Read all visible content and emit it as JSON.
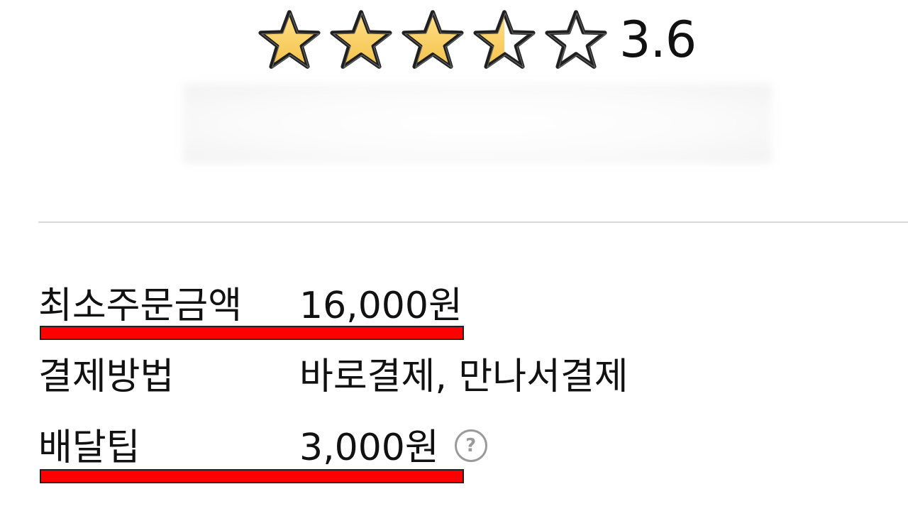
{
  "rating": {
    "value_text": "3.6",
    "value": 3.6,
    "max": 5,
    "star_fill_color": "#F4C24A",
    "stars": [
      {
        "fill": "full"
      },
      {
        "fill": "full"
      },
      {
        "fill": "full"
      },
      {
        "fill": "half"
      },
      {
        "fill": "empty"
      }
    ]
  },
  "info": {
    "min_order": {
      "label": "최소주문금액",
      "value": "16,000원"
    },
    "payment": {
      "label": "결제방법",
      "value": "바로결제, 만나서결제"
    },
    "delivery_tip": {
      "label": "배달팁",
      "value": "3,000원",
      "help_icon": "question-circle-icon",
      "help_glyph": "?"
    }
  },
  "colors": {
    "highlight": "#FF0000",
    "divider": "#D9D9D9",
    "help_icon": "#9A9A9A"
  }
}
